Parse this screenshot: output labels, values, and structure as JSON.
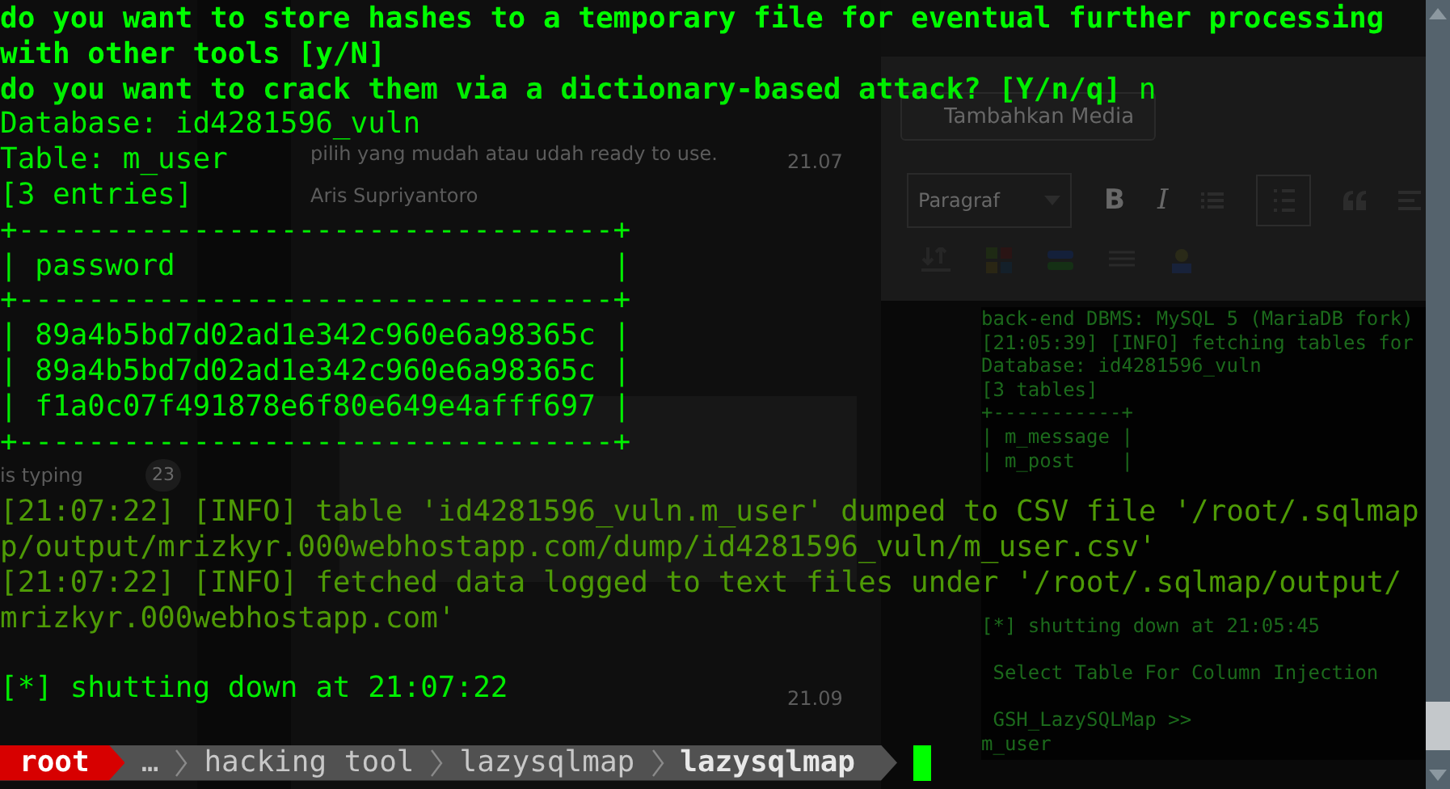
{
  "background": {
    "chat": {
      "message": "pilih yang mudah atau udah ready to use.",
      "message_time": "21.07",
      "sender": "Aris Supriyantoro",
      "typing": "is typing",
      "unread": "23",
      "later_time": "21.09"
    },
    "editor": {
      "media_button": "Tambahkan Media",
      "paragraph_select": "Paragraf",
      "format_buttons": [
        "B",
        "I"
      ]
    },
    "terminal": {
      "lines": [
        {
          "kind": "text",
          "text": "back-end DBMS: MySQL 5 (MariaDB fork)"
        },
        {
          "kind": "text",
          "text": "[21:05:39] [INFO] fetching tables for"
        },
        {
          "kind": "text",
          "text": "Database: id4281596_vuln"
        },
        {
          "kind": "text",
          "text": "[3 tables]"
        },
        {
          "kind": "text",
          "text": "+-----------+"
        },
        {
          "kind": "text",
          "text": "| m_message |"
        },
        {
          "kind": "text",
          "text": "| m_post    |"
        },
        {
          "kind": "blank"
        },
        {
          "kind": "blank"
        },
        {
          "kind": "blank"
        },
        {
          "kind": "blank"
        },
        {
          "kind": "blank"
        },
        {
          "kind": "blank"
        },
        {
          "kind": "text",
          "text": "[*] shutting down at 21:05:45"
        },
        {
          "kind": "blank"
        },
        {
          "kind": "text",
          "text": " Select Table For Column Injection"
        },
        {
          "kind": "blank"
        },
        {
          "kind": "text",
          "text": " GSH_LazySQLMap >>"
        },
        {
          "kind": "text",
          "text": "m_user"
        }
      ]
    }
  },
  "terminal": {
    "lines": [
      {
        "kind": "bold",
        "text": "do you want to store hashes to a temporary file for eventual further processing"
      },
      {
        "kind": "bold",
        "text": "with other tools [y/N]"
      },
      {
        "kind": "text",
        "text": "**do you want to crack them via a dictionary-based attack? [Y/n/q]** n"
      },
      {
        "kind": "text",
        "text": "Database: id4281596_vuln"
      },
      {
        "kind": "text",
        "text": "Table: m_user"
      },
      {
        "kind": "text",
        "text": "[3 entries]"
      },
      {
        "kind": "text",
        "text": "+----------------------------------+"
      },
      {
        "kind": "text",
        "text": "| password                         |"
      },
      {
        "kind": "text",
        "text": "+----------------------------------+"
      },
      {
        "kind": "text",
        "text": "| 89a4b5bd7d02ad1e342c960e6a98365c |"
      },
      {
        "kind": "text",
        "text": "| 89a4b5bd7d02ad1e342c960e6a98365c |"
      },
      {
        "kind": "text",
        "text": "| f1a0c07f491878e6f80e649e4afff697 |"
      },
      {
        "kind": "text",
        "text": "+----------------------------------+"
      },
      {
        "kind": "blank"
      },
      {
        "kind": "info",
        "text": "[21:07:22] [INFO] table 'id4281596_vuln.m_user' dumped to CSV file '/root/.sqlmap"
      },
      {
        "kind": "info",
        "text": "p/output/mrizkyr.000webhostapp.com/dump/id4281596_vuln/m_user.csv'"
      },
      {
        "kind": "info",
        "text": "[21:07:22] [INFO] fetched data logged to text files under '/root/.sqlmap/output/"
      },
      {
        "kind": "info",
        "text": "mrizkyr.000webhostapp.com'"
      },
      {
        "kind": "blank"
      },
      {
        "kind": "text",
        "text": "[*] shutting down at 21:07:22"
      },
      {
        "kind": "blank"
      }
    ],
    "prompt": [
      {
        "kind": "user",
        "text": "root"
      },
      {
        "kind": "dir",
        "text": "…"
      },
      {
        "kind": "dir",
        "text": "hacking tool"
      },
      {
        "kind": "dir",
        "text": "lazysqlmap"
      },
      {
        "kind": "current",
        "text": "lazysqlmap"
      }
    ]
  }
}
